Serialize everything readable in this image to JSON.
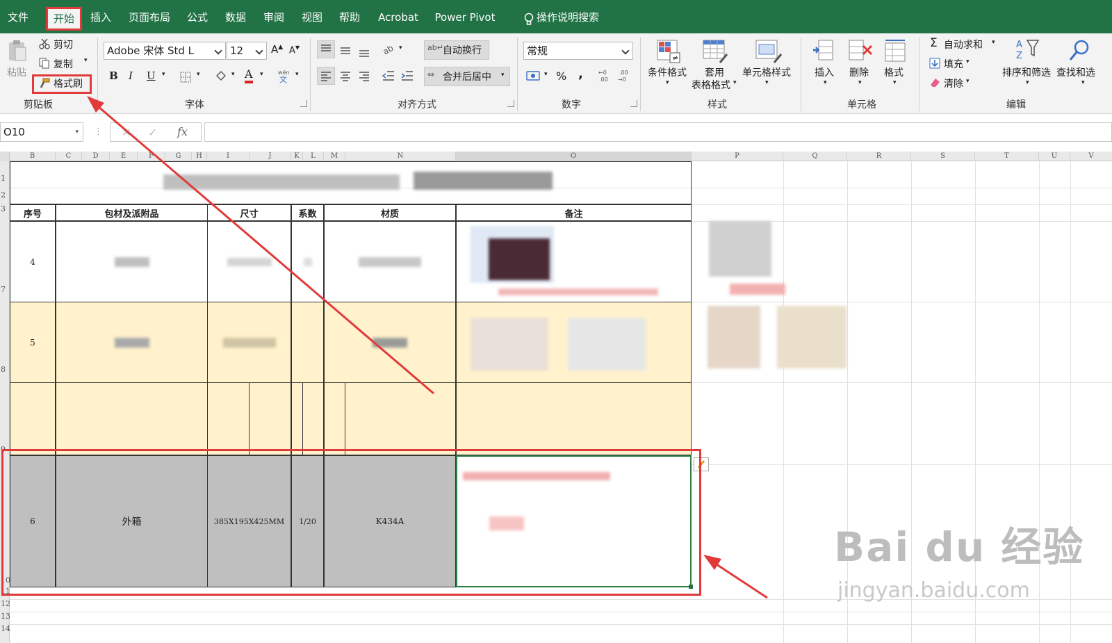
{
  "menu": {
    "tabs": [
      "文件",
      "开始",
      "插入",
      "页面布局",
      "公式",
      "数据",
      "审阅",
      "视图",
      "帮助",
      "Acrobat",
      "Power Pivot"
    ],
    "active_tab": "开始",
    "search_label": "操作说明搜索"
  },
  "ribbon": {
    "clipboard": {
      "paste": "粘贴",
      "cut": "剪切",
      "copy": "复制",
      "format_painter": "格式刷",
      "label": "剪贴板"
    },
    "font": {
      "name": "Adobe 宋体 Std L",
      "size": "12",
      "bold": "B",
      "italic": "I",
      "underline": "U",
      "color_letter": "A",
      "label": "字体"
    },
    "alignment": {
      "wrap_text": "自动换行",
      "merge_center": "合并后居中",
      "label": "对齐方式"
    },
    "number": {
      "format": "常规",
      "percent": "%",
      "comma": ",",
      "label": "数字"
    },
    "styles": {
      "conditional": "条件格式",
      "table_top": "套用",
      "table_bottom": "表格格式",
      "cell_styles": "单元格样式",
      "label": "样式"
    },
    "cells": {
      "insert": "插入",
      "delete": "删除",
      "format": "格式",
      "label": "单元格"
    },
    "editing": {
      "autosum": "自动求和",
      "fill": "填充",
      "clear": "清除",
      "sort_filter": "排序和筛选",
      "find_select": "查找和选",
      "label": "编辑"
    }
  },
  "formula_bar": {
    "name_box": "O10",
    "fx": "fx",
    "value": ""
  },
  "columns": [
    "B",
    "C",
    "D",
    "E",
    "F",
    "G",
    "H",
    "I",
    "J",
    "K",
    "L",
    "M",
    "N",
    "O",
    "P",
    "Q",
    "R",
    "S",
    "T",
    "U",
    "V"
  ],
  "rows": [
    "1",
    "2",
    "3",
    "7",
    "8",
    "9",
    "10",
    "11",
    "12",
    "13",
    "14"
  ],
  "table": {
    "headers": [
      "序号",
      "包材及派附品",
      "尺寸",
      "系数",
      "材质",
      "备注"
    ],
    "row_4_index": "4",
    "row_5_index": "5",
    "row_6": {
      "index": "6",
      "item": "外箱",
      "size": "385X195X425MM",
      "factor": "1/20",
      "material": "K434A"
    }
  },
  "watermark": {
    "brand": "Bai du 经验",
    "url": "jingyan.baidu.com"
  },
  "colors": {
    "excel_green": "#217346",
    "highlight_red": "#e03a3a",
    "row_yellow": "#fff2cc",
    "row_gray": "#bfbfbf"
  }
}
